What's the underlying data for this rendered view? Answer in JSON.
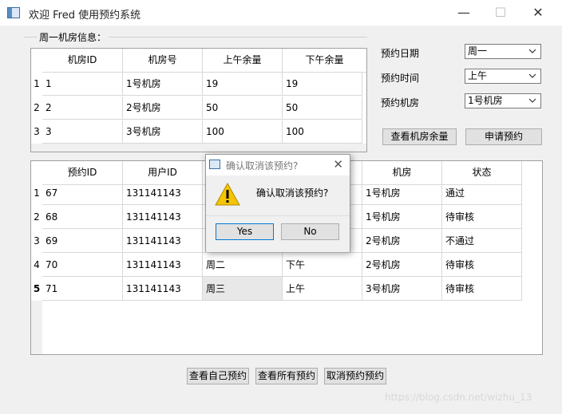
{
  "window": {
    "title": "欢迎 Fred 使用预约系统",
    "minimize": "—",
    "maximize": "☐",
    "close": "✕"
  },
  "room_group": {
    "label": "周一机房信息："
  },
  "room_table": {
    "headers": [
      "机房ID",
      "机房号",
      "上午余量",
      "下午余量"
    ],
    "row_numbers": [
      "1",
      "2",
      "3"
    ],
    "rows": [
      [
        "1",
        "1号机房",
        "19",
        "19"
      ],
      [
        "2",
        "2号机房",
        "50",
        "50"
      ],
      [
        "3",
        "3号机房",
        "100",
        "100"
      ]
    ]
  },
  "form": {
    "date_label": "预约日期",
    "time_label": "预约时间",
    "room_label": "预约机房",
    "date_value": "周一",
    "time_value": "上午",
    "room_value": "1号机房",
    "view_rooms_button": "查看机房余量",
    "apply_button": "申请预约"
  },
  "order_table": {
    "headers": [
      "预约ID",
      "用户ID",
      "",
      "",
      "机房",
      "状态"
    ],
    "row_numbers": [
      "1",
      "2",
      "3",
      "4",
      "5"
    ],
    "rows": [
      [
        "67",
        "131141143",
        "",
        "",
        "1号机房",
        "通过"
      ],
      [
        "68",
        "131141143",
        "",
        "",
        "1号机房",
        "待审核"
      ],
      [
        "69",
        "131141143",
        "",
        "",
        "2号机房",
        "不通过"
      ],
      [
        "70",
        "131141143",
        "周二",
        "下午",
        "2号机房",
        "待审核"
      ],
      [
        "71",
        "131141143",
        "周三",
        "上午",
        "3号机房",
        "待审核"
      ]
    ]
  },
  "bottom_buttons": {
    "my_orders": "查看自己预约",
    "all_orders": "查看所有预约",
    "cancel_order": "取消预约预约"
  },
  "dialog": {
    "title": "确认取消该预约?",
    "message": "确认取消该预约?",
    "yes": "Yes",
    "no": "No",
    "close": "✕"
  },
  "watermark": "https://blog.csdn.net/wizhu_13"
}
